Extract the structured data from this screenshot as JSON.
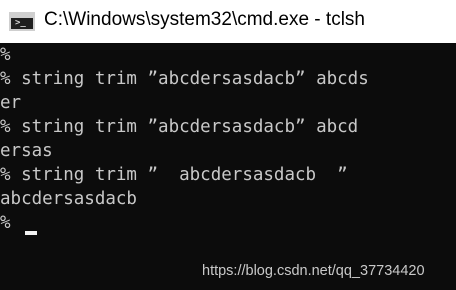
{
  "window": {
    "title": "C:\\Windows\\system32\\cmd.exe - tclsh",
    "icon": "console-icon",
    "icon_glyph": ">_"
  },
  "console": {
    "lines": [
      "%",
      "% string trim ”abcdersasdacb” abcds",
      "er",
      "% string trim ”abcdersasdacb” abcd",
      "ersas",
      "% string trim ”  abcdersasdacb  ”",
      "abcdersasdacb",
      "%"
    ]
  },
  "watermark": "https://blog.csdn.net/qq_37734420",
  "colors": {
    "background": "#0c0c0c",
    "text": "#c8c8c8",
    "titlebar": "#ffffff"
  }
}
